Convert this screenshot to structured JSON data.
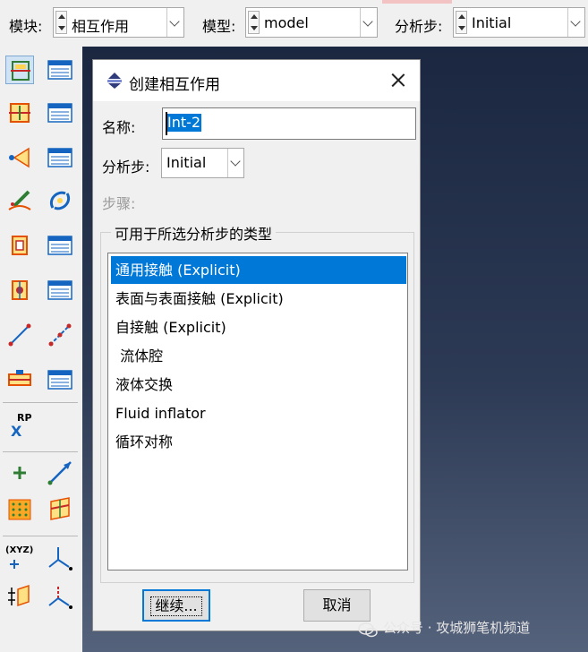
{
  "topbar": {
    "module_label": "模块:",
    "module_value": "相互作用",
    "model_label": "模型:",
    "model_value": "model",
    "step_label": "分析步:",
    "step_value": "Initial"
  },
  "toolbox": {
    "rp_label": "RP",
    "rp_mark": "X",
    "xyz_label": "(XYZ)"
  },
  "dialog": {
    "title": "创建相互作用",
    "name_label": "名称:",
    "name_value": "Int-2",
    "step_label": "分析步:",
    "step_value": "Initial",
    "procedure_label": "步骤:",
    "group_title": "可用于所选分析步的类型",
    "types": [
      {
        "label": "通用接触 (Explicit)",
        "selected": true
      },
      {
        "label": "表面与表面接触 (Explicit)",
        "selected": false
      },
      {
        "label": "自接触 (Explicit)",
        "selected": false
      },
      {
        "label": " 流体腔",
        "selected": false
      },
      {
        "label": "液体交换",
        "selected": false
      },
      {
        "label": "Fluid inflator",
        "selected": false
      },
      {
        "label": "循环对称",
        "selected": false
      }
    ],
    "continue_label": "继续...",
    "cancel_label": "取消"
  },
  "watermark": {
    "text": "公众号 · 攻城狮笔机频道"
  },
  "colors": {
    "selection": "#0078d7",
    "viewport_top": "#1b2740",
    "viewport_bottom": "#55627b",
    "panel": "#f0f0f0"
  }
}
